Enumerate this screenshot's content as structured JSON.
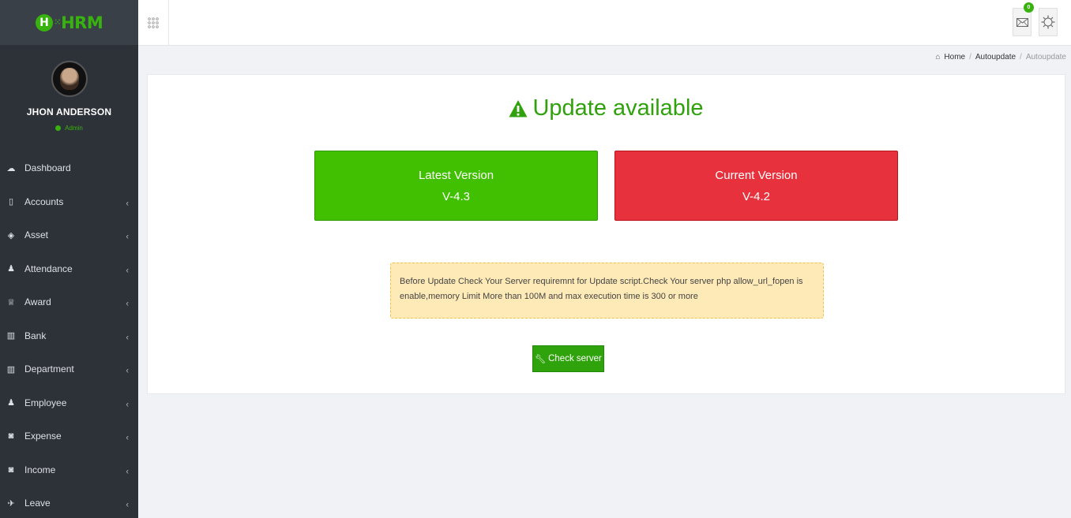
{
  "app": {
    "logo_letter": "H",
    "logo_text": "HRM"
  },
  "user": {
    "name": "JHON ANDERSON",
    "role": "Admin"
  },
  "sidebar": {
    "items": [
      {
        "label": "Dashboard",
        "icon": "dashboard-icon",
        "glyph": "☁",
        "has_children": false
      },
      {
        "label": "Accounts",
        "icon": "accounts-icon",
        "glyph": "▯",
        "has_children": true
      },
      {
        "label": "Asset",
        "icon": "diamond-icon",
        "glyph": "◈",
        "has_children": true
      },
      {
        "label": "Attendance",
        "icon": "user-icon",
        "glyph": "♟",
        "has_children": true
      },
      {
        "label": "Award",
        "icon": "trophy-icon",
        "glyph": "♕",
        "has_children": true
      },
      {
        "label": "Bank",
        "icon": "bank-icon",
        "glyph": "▥",
        "has_children": true
      },
      {
        "label": "Department",
        "icon": "bank-icon",
        "glyph": "▥",
        "has_children": true
      },
      {
        "label": "Employee",
        "icon": "users-icon",
        "glyph": "♟",
        "has_children": true
      },
      {
        "label": "Expense",
        "icon": "money-icon",
        "glyph": "◙",
        "has_children": true
      },
      {
        "label": "Income",
        "icon": "money-icon",
        "glyph": "◙",
        "has_children": true
      },
      {
        "label": "Leave",
        "icon": "plane-icon",
        "glyph": "✈",
        "has_children": true
      }
    ]
  },
  "topbar": {
    "mail_count": "0"
  },
  "breadcrumb": {
    "home": "Home",
    "parent": "Autoupdate",
    "current": "Autoupdate"
  },
  "main": {
    "title": "Update available",
    "latest": {
      "label": "Latest Version",
      "value": "V-4.3"
    },
    "current": {
      "label": "Current Version",
      "value": "V-4.2"
    },
    "notice": "Before Update Check Your Server requiremnt for Update script.Check Your server php allow_url_fopen is enable,memory Limit More than 100M and max execution time is 300 or more",
    "check_button": "Check server"
  },
  "colors": {
    "brand_green": "#37b20e",
    "latest_bg": "#40c000",
    "current_bg": "#e7323e",
    "notice_bg": "#feeab7",
    "sidebar_bg": "#2d3239"
  }
}
